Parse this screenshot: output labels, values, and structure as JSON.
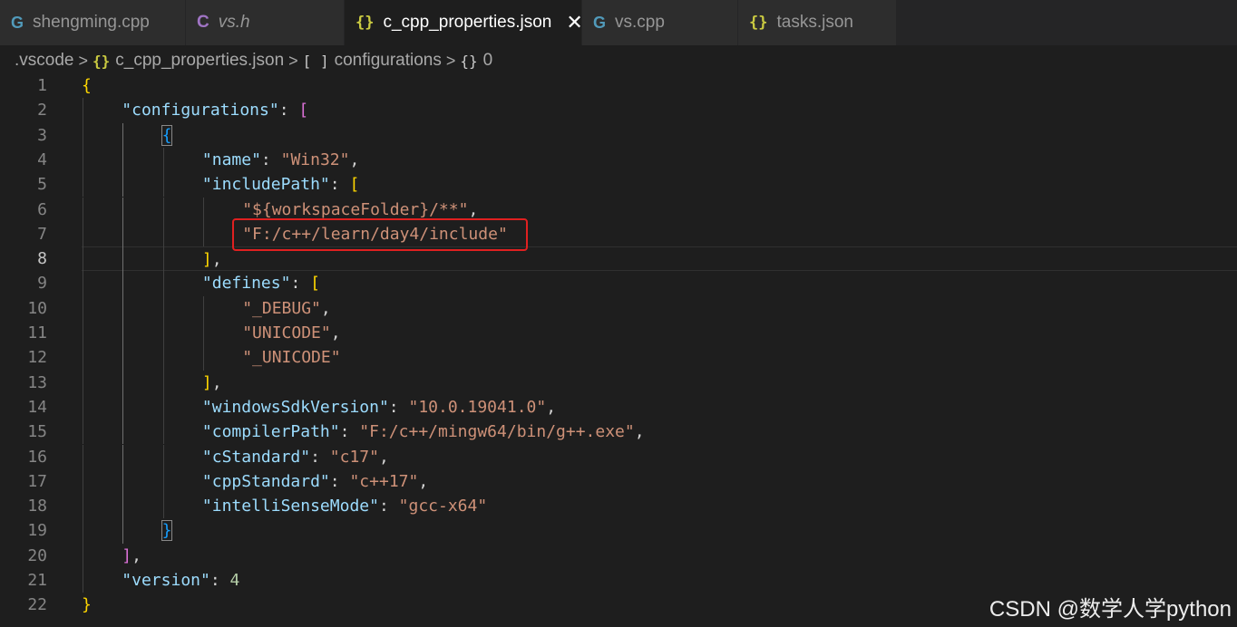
{
  "tabs": [
    {
      "label": "shengming.cpp",
      "icon": "cpp-file-icon",
      "glyph": "G",
      "kind": "cpp",
      "italic": false,
      "active": false
    },
    {
      "label": "vs.h",
      "icon": "c-header-file-icon",
      "glyph": "C",
      "kind": "c",
      "italic": true,
      "active": false
    },
    {
      "label": "c_cpp_properties.json",
      "icon": "json-file-icon",
      "glyph": "{}",
      "kind": "json",
      "italic": false,
      "active": true
    },
    {
      "label": "vs.cpp",
      "icon": "cpp-file-icon",
      "glyph": "G",
      "kind": "cpp",
      "italic": false,
      "active": false
    },
    {
      "label": "tasks.json",
      "icon": "json-file-icon",
      "glyph": "{}",
      "kind": "json",
      "italic": false,
      "active": false
    }
  ],
  "close_glyph": "✕",
  "breadcrumb": {
    "folder": ".vscode",
    "file": "c_cpp_properties.json",
    "file_glyph": "{}",
    "array": "configurations",
    "array_glyph": "[ ]",
    "object": "0",
    "object_glyph": "{}",
    "separator": ">"
  },
  "editor": {
    "current_line": 8,
    "lines": [
      {
        "n": "1",
        "indent": 0,
        "tokens": [
          [
            "b1",
            "{"
          ]
        ]
      },
      {
        "n": "2",
        "indent": 1,
        "tokens": [
          [
            "key",
            "\"configurations\""
          ],
          [
            "punc",
            ": "
          ],
          [
            "b2",
            "["
          ]
        ]
      },
      {
        "n": "3",
        "indent": 2,
        "tokens": [
          [
            "b3",
            "{"
          ]
        ],
        "match": true
      },
      {
        "n": "4",
        "indent": 3,
        "tokens": [
          [
            "key",
            "\"name\""
          ],
          [
            "punc",
            ": "
          ],
          [
            "str",
            "\"Win32\""
          ],
          [
            "punc",
            ","
          ]
        ]
      },
      {
        "n": "5",
        "indent": 3,
        "tokens": [
          [
            "key",
            "\"includePath\""
          ],
          [
            "punc",
            ": "
          ],
          [
            "b1",
            "["
          ]
        ]
      },
      {
        "n": "6",
        "indent": 4,
        "tokens": [
          [
            "str",
            "\"${workspaceFolder}/**\""
          ],
          [
            "punc",
            ","
          ]
        ]
      },
      {
        "n": "7",
        "indent": 4,
        "tokens": [
          [
            "str",
            "\"F:/c++/learn/day4/include\""
          ]
        ]
      },
      {
        "n": "8",
        "indent": 3,
        "tokens": [
          [
            "b1",
            "]"
          ],
          [
            "punc",
            ","
          ]
        ]
      },
      {
        "n": "9",
        "indent": 3,
        "tokens": [
          [
            "key",
            "\"defines\""
          ],
          [
            "punc",
            ": "
          ],
          [
            "b1",
            "["
          ]
        ]
      },
      {
        "n": "10",
        "indent": 4,
        "tokens": [
          [
            "str",
            "\"_DEBUG\""
          ],
          [
            "punc",
            ","
          ]
        ]
      },
      {
        "n": "11",
        "indent": 4,
        "tokens": [
          [
            "str",
            "\"UNICODE\""
          ],
          [
            "punc",
            ","
          ]
        ]
      },
      {
        "n": "12",
        "indent": 4,
        "tokens": [
          [
            "str",
            "\"_UNICODE\""
          ]
        ]
      },
      {
        "n": "13",
        "indent": 3,
        "tokens": [
          [
            "b1",
            "]"
          ],
          [
            "punc",
            ","
          ]
        ]
      },
      {
        "n": "14",
        "indent": 3,
        "tokens": [
          [
            "key",
            "\"windowsSdkVersion\""
          ],
          [
            "punc",
            ": "
          ],
          [
            "str",
            "\"10.0.19041.0\""
          ],
          [
            "punc",
            ","
          ]
        ]
      },
      {
        "n": "15",
        "indent": 3,
        "tokens": [
          [
            "key",
            "\"compilerPath\""
          ],
          [
            "punc",
            ": "
          ],
          [
            "str",
            "\"F:/c++/mingw64/bin/g++.exe\""
          ],
          [
            "punc",
            ","
          ]
        ]
      },
      {
        "n": "16",
        "indent": 3,
        "tokens": [
          [
            "key",
            "\"cStandard\""
          ],
          [
            "punc",
            ": "
          ],
          [
            "str",
            "\"c17\""
          ],
          [
            "punc",
            ","
          ]
        ]
      },
      {
        "n": "17",
        "indent": 3,
        "tokens": [
          [
            "key",
            "\"cppStandard\""
          ],
          [
            "punc",
            ": "
          ],
          [
            "str",
            "\"c++17\""
          ],
          [
            "punc",
            ","
          ]
        ]
      },
      {
        "n": "18",
        "indent": 3,
        "tokens": [
          [
            "key",
            "\"intelliSenseMode\""
          ],
          [
            "punc",
            ": "
          ],
          [
            "str",
            "\"gcc-x64\""
          ]
        ]
      },
      {
        "n": "19",
        "indent": 2,
        "tokens": [
          [
            "b3",
            "}"
          ]
        ],
        "match": true
      },
      {
        "n": "20",
        "indent": 1,
        "tokens": [
          [
            "b2",
            "]"
          ],
          [
            "punc",
            ","
          ]
        ]
      },
      {
        "n": "21",
        "indent": 1,
        "tokens": [
          [
            "key",
            "\"version\""
          ],
          [
            "punc",
            ": "
          ],
          [
            "num",
            "4"
          ]
        ]
      },
      {
        "n": "22",
        "indent": 0,
        "tokens": [
          [
            "b1",
            "}"
          ]
        ]
      }
    ]
  },
  "colors": {
    "key": "#9cdcfe",
    "string": "#ce9178",
    "number": "#b5cea8",
    "bracket_level1": "#ffd700",
    "bracket_level2": "#da70d6",
    "bracket_level3": "#179fff",
    "annotation_box": "#e02020"
  },
  "watermark": "CSDN @数学人学python"
}
